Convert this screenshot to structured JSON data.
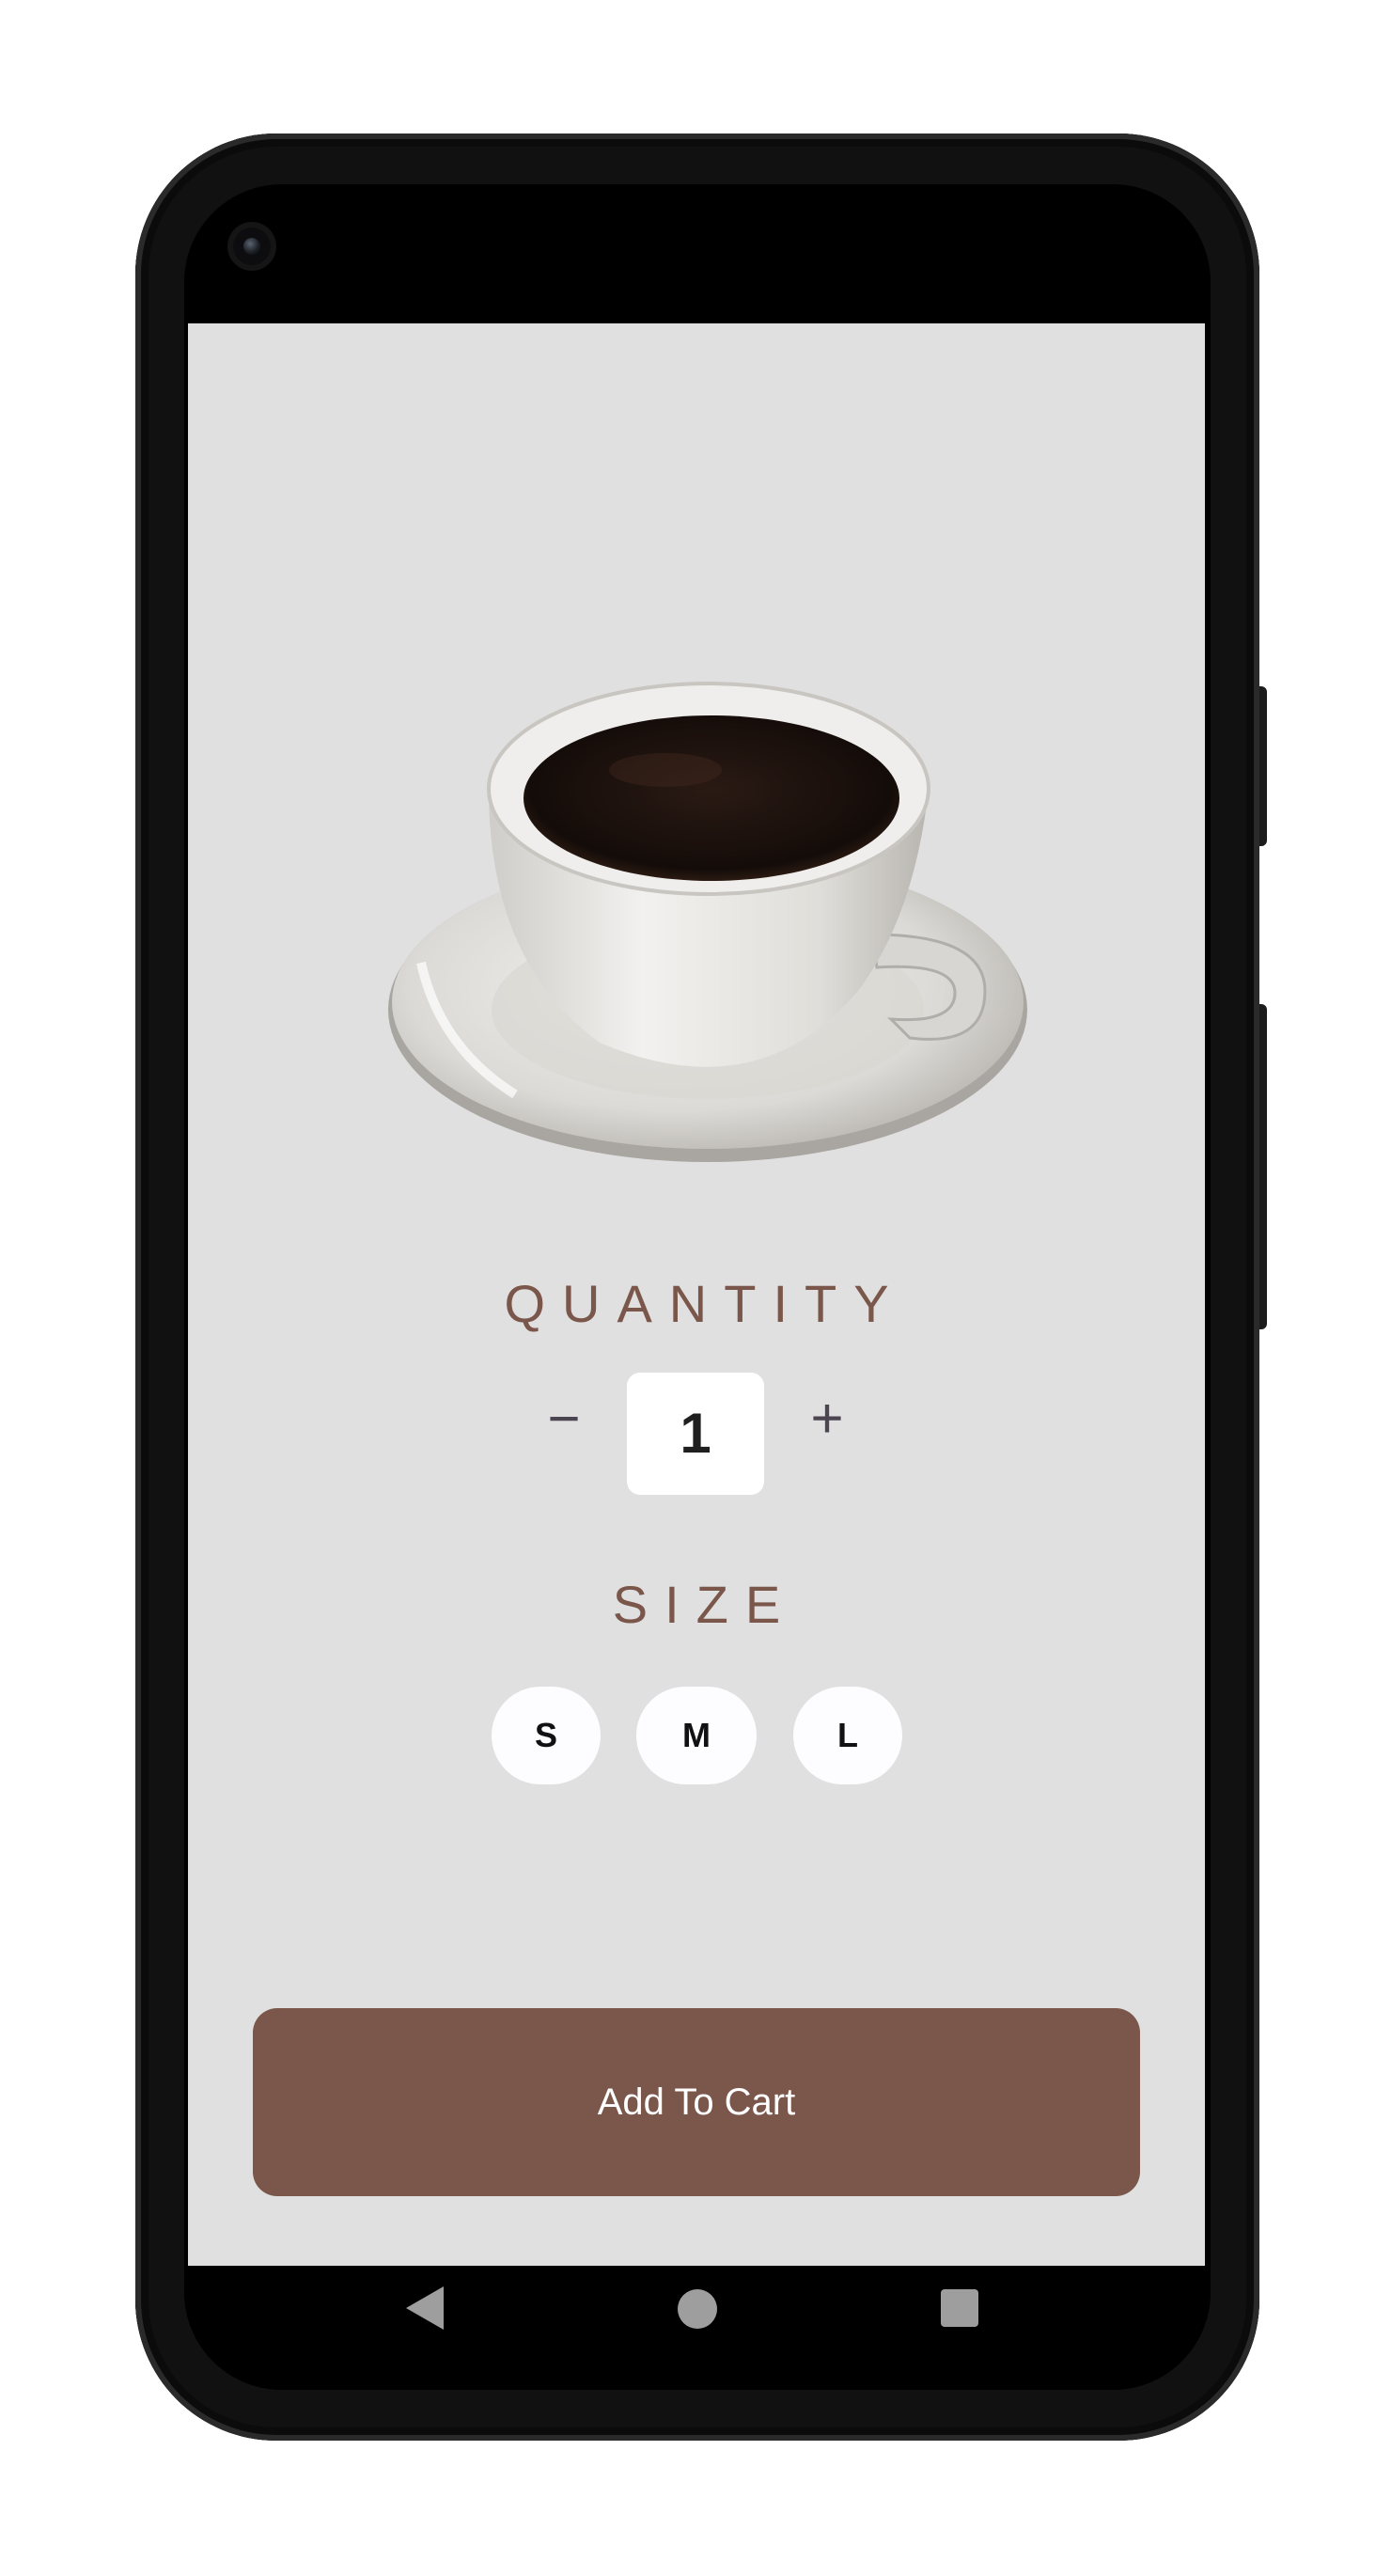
{
  "product": {
    "image_description": "white cup of black coffee on a saucer"
  },
  "quantity": {
    "title": "QUANTITY",
    "decrement_symbol": "−",
    "increment_symbol": "+",
    "value": "1"
  },
  "size": {
    "title": "SIZE",
    "options": [
      {
        "label": "S"
      },
      {
        "label": "M"
      },
      {
        "label": "L"
      }
    ]
  },
  "cart": {
    "button_label": "Add To Cart"
  },
  "colors": {
    "accent": "#7a574a",
    "screen_background": "#e0e0e0",
    "chip_background": "#fdfcff"
  },
  "nav_bar": {
    "icons": [
      "back-icon",
      "home-icon",
      "recents-icon"
    ]
  }
}
